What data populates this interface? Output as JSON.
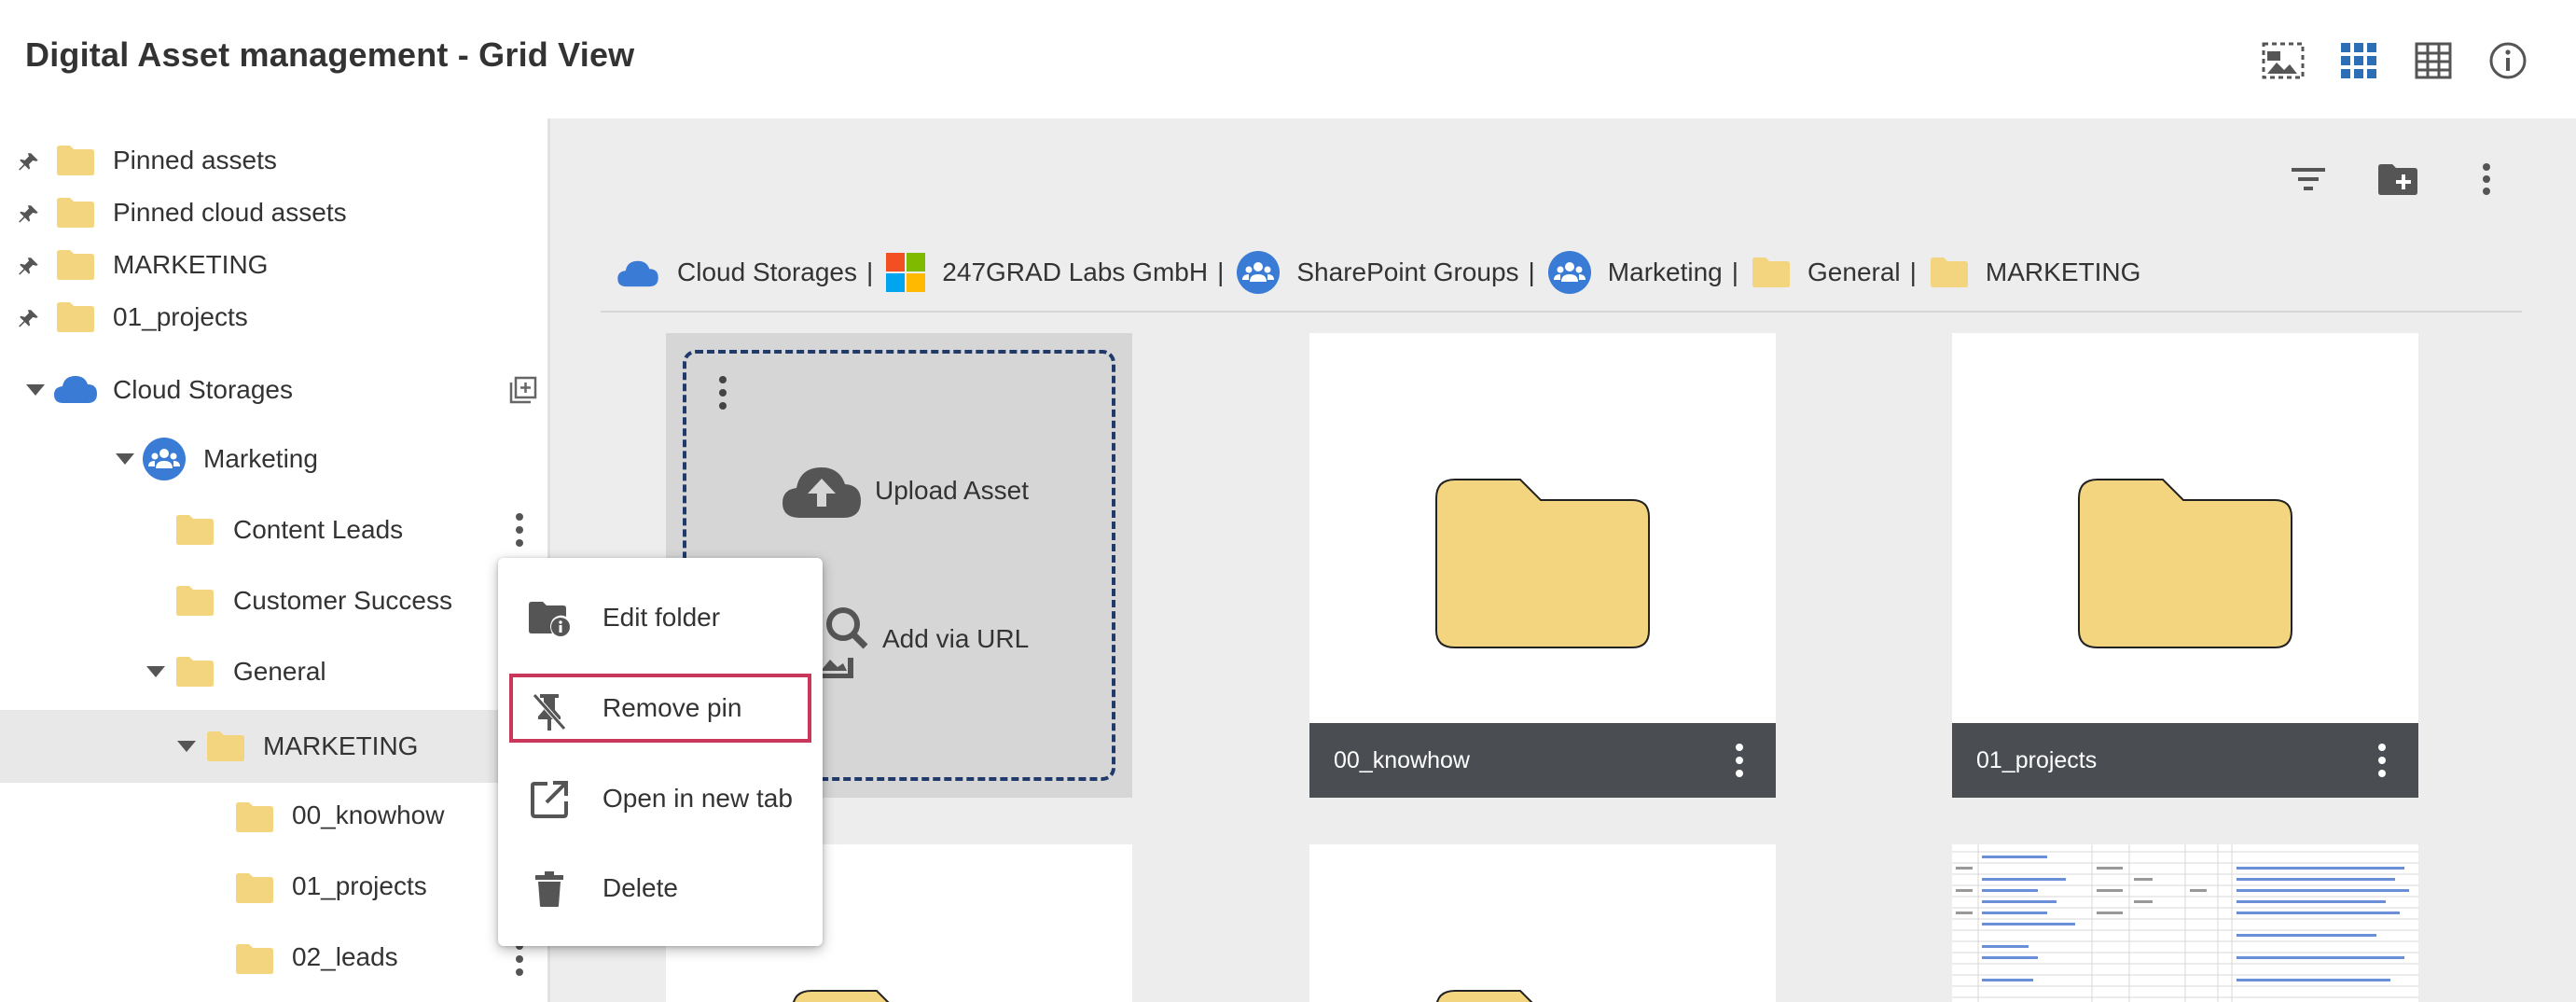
{
  "header": {
    "title": "Digital Asset management - Grid View",
    "icons": [
      "image-select-icon",
      "grid-view-icon",
      "table-view-icon",
      "info-icon"
    ]
  },
  "sidebar": {
    "pinned": [
      {
        "label": "Pinned assets"
      },
      {
        "label": "Pinned cloud assets"
      },
      {
        "label": "MARKETING"
      },
      {
        "label": "01_projects"
      }
    ],
    "tree": {
      "cloud_storages": "Cloud Storages",
      "marketing_group": "Marketing",
      "content_leads": "Content Leads",
      "customer_success": "Customer Success",
      "general": "General",
      "marketing_folder": "MARKETING",
      "knowhow": "00_knowhow",
      "projects": "01_projects",
      "leads": "02_leads"
    }
  },
  "breadcrumb": {
    "items": [
      "Cloud Storages",
      "247GRAD Labs GmbH",
      "SharePoint Groups",
      "Marketing",
      "General",
      "MARKETING"
    ],
    "separator": "|"
  },
  "upload": {
    "upload_label": "Upload Asset",
    "url_label": "Add via URL"
  },
  "cards": [
    {
      "name": "00_knowhow"
    },
    {
      "name": "01_projects"
    }
  ],
  "context_menu": {
    "items": [
      {
        "label": "Edit folder",
        "icon": "folder-info-icon"
      },
      {
        "label": "Remove pin",
        "icon": "unpin-icon"
      },
      {
        "label": "Open in new tab",
        "icon": "open-in-new-icon"
      },
      {
        "label": "Delete",
        "icon": "trash-icon"
      }
    ]
  },
  "colors": {
    "accent_blue": "#2d6fb5",
    "folder_yellow": "#f2d57e",
    "card_footer": "#4a4d52",
    "highlight": "#c9375a"
  }
}
